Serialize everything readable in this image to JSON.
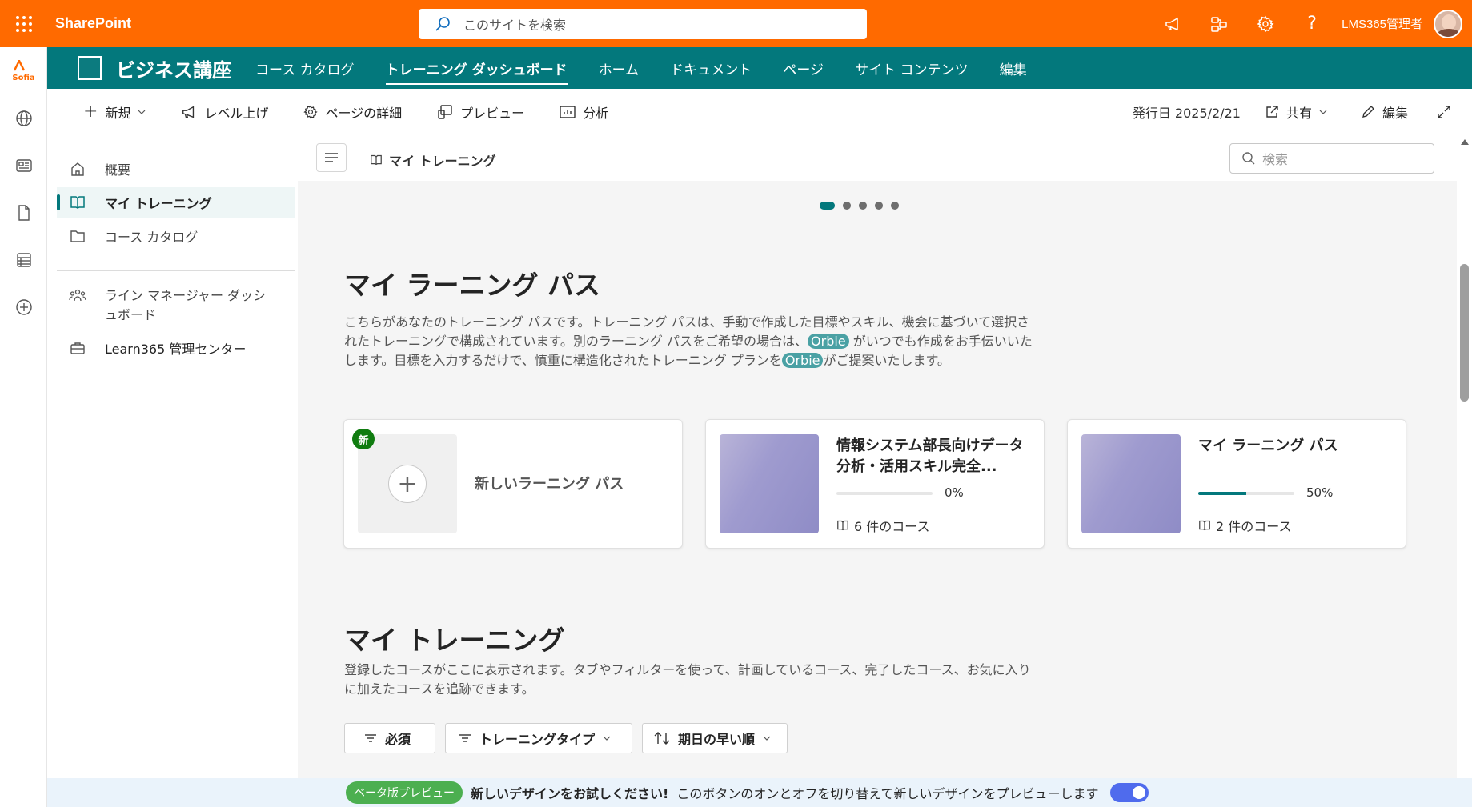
{
  "topbar": {
    "brand": "SharePoint",
    "search_placeholder": "このサイトを検索",
    "user_name": "LMS365管理者"
  },
  "rail": {
    "logo_text": "Sofia"
  },
  "site": {
    "title": "ビジネス講座",
    "nav": [
      {
        "label": "コース カタログ"
      },
      {
        "label": "トレーニング ダッシュボード",
        "active": true
      },
      {
        "label": "ホーム"
      },
      {
        "label": "ドキュメント"
      },
      {
        "label": "ページ"
      },
      {
        "label": "サイト コンテンツ"
      },
      {
        "label": "編集"
      }
    ]
  },
  "commandbar": {
    "new": "新規",
    "promote": "レベル上げ",
    "page_details": "ページの詳細",
    "preview": "プレビュー",
    "analytics": "分析",
    "published": "発行日 2025/2/21",
    "share": "共有",
    "edit": "編集"
  },
  "leftnav": {
    "items": [
      {
        "label": "概要"
      },
      {
        "label": "マイ トレーニング",
        "active": true
      },
      {
        "label": "コース カタログ"
      },
      {
        "label": "ライン マネージャー ダッシュボード"
      },
      {
        "label": "Learn365 管理センター"
      }
    ]
  },
  "main": {
    "breadcrumb": "マイ トレーニング",
    "search_placeholder": "検索",
    "carousel": {
      "count": 5,
      "active": 0
    },
    "learning_paths": {
      "heading": "マイ ラーニング パス",
      "description_1": "こちらがあなたのトレーニング パスです。トレーニング パスは、手動で作成した目標やスキル、機会に基づいて選択されたトレーニングで構成されています。別のラーニング パスをご希望の場合は、",
      "orbie": "Orbie",
      "description_2": " がいつでも作成をお手伝いいたします。目標を入力するだけで、慎重に構造化されたトレーニング プランを",
      "description_3": "がご提案いたします。",
      "new_badge": "新",
      "new_card": "新しいラーニング パス",
      "cards": [
        {
          "title": "情報システム部長向けデータ分析・活用スキル完全...",
          "progress": 0,
          "progress_label": "0%",
          "courses": "6 件のコース"
        },
        {
          "title": "マイ ラーニング パス",
          "progress": 50,
          "progress_label": "50%",
          "courses": "2 件のコース"
        }
      ]
    },
    "my_training": {
      "heading": "マイ トレーニング",
      "description": "登録したコースがここに表示されます。タブやフィルターを使って、計画しているコース、完了したコース、お気に入りに加えたコースを追跡できます。",
      "filters": {
        "required": "必須",
        "training_type": "トレーニングタイプ",
        "sort": "期日の早い順"
      }
    }
  },
  "beta": {
    "pill": "ベータ版プレビュー",
    "headline": "新しいデザインをお試しください!",
    "text": "このボタンのオンとオフを切り替えて新しいデザインをプレビューします",
    "toggle_on": true
  }
}
